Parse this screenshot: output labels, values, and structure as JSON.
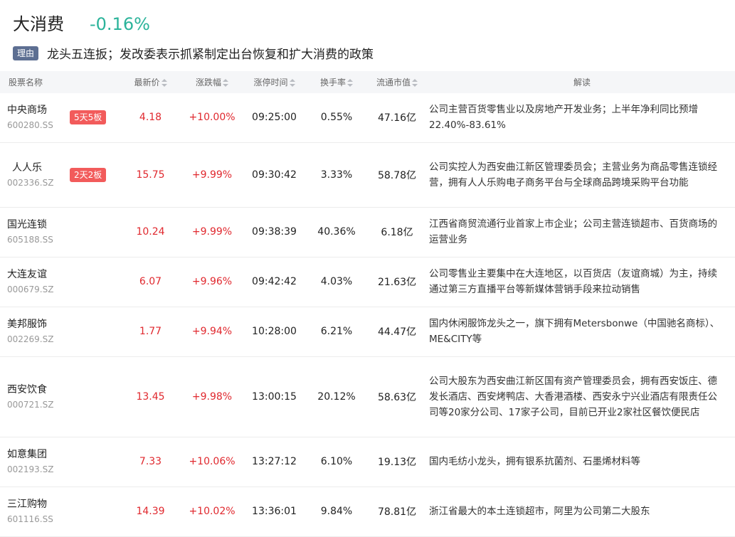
{
  "header": {
    "sector_name": "大消费",
    "sector_change": "-0.16%",
    "reason_tag": "理由",
    "reason_text": "龙头五连扳；发改委表示抓紧制定出台恢复和扩大消费的政策"
  },
  "table": {
    "columns": [
      "股票名称",
      "最新价",
      "涨跌幅",
      "涨停时间",
      "换手率",
      "流通市值",
      "解读"
    ],
    "rows": [
      {
        "name": "中央商场",
        "code": "600280.SS",
        "badge": "5天5板",
        "price": "4.18",
        "change": "+10.00%",
        "limit_time": "09:25:00",
        "turnover": "0.55%",
        "market_cap": "47.16亿",
        "desc": "公司主营百货零售业以及房地产开发业务；上半年净利同比预增22.40%-83.61%"
      },
      {
        "name": "人人乐",
        "code": "002336.SZ",
        "badge": "2天2板",
        "price": "15.75",
        "change": "+9.99%",
        "limit_time": "09:30:42",
        "turnover": "3.33%",
        "market_cap": "58.78亿",
        "desc": "公司实控人为西安曲江新区管理委员会；主营业务为商品零售连锁经营，拥有人人乐购电子商务平台与全球商品跨境采购平台功能"
      },
      {
        "name": "国光连锁",
        "code": "605188.SS",
        "badge": "",
        "price": "10.24",
        "change": "+9.99%",
        "limit_time": "09:38:39",
        "turnover": "40.36%",
        "market_cap": "6.18亿",
        "desc": "江西省商贸流通行业首家上市企业；公司主营连锁超市、百货商场的运营业务"
      },
      {
        "name": "大连友谊",
        "code": "000679.SZ",
        "badge": "",
        "price": "6.07",
        "change": "+9.96%",
        "limit_time": "09:42:42",
        "turnover": "4.03%",
        "market_cap": "21.63亿",
        "desc": "公司零售业主要集中在大连地区，以百货店（友谊商城）为主，持续通过第三方直播平台等新媒体营销手段来拉动销售"
      },
      {
        "name": "美邦服饰",
        "code": "002269.SZ",
        "badge": "",
        "price": "1.77",
        "change": "+9.94%",
        "limit_time": "10:28:00",
        "turnover": "6.21%",
        "market_cap": "44.47亿",
        "desc": "国内休闲服饰龙头之一，旗下拥有Metersbonwe（中国驰名商标）、ME&CITY等"
      },
      {
        "name": "西安饮食",
        "code": "000721.SZ",
        "badge": "",
        "price": "13.45",
        "change": "+9.98%",
        "limit_time": "13:00:15",
        "turnover": "20.12%",
        "market_cap": "58.63亿",
        "desc": "公司大股东为西安曲江新区国有资产管理委员会，拥有西安饭庄、德发长酒店、西安烤鸭店、大香港酒楼、西安永宁兴业酒店有限责任公司等20家分公司、17家子公司，目前已开业2家社区餐饮便民店"
      },
      {
        "name": "如意集团",
        "code": "002193.SZ",
        "badge": "",
        "price": "7.33",
        "change": "+10.06%",
        "limit_time": "13:27:12",
        "turnover": "6.10%",
        "market_cap": "19.13亿",
        "desc": "国内毛纺小龙头，拥有银系抗菌剂、石墨烯材料等"
      },
      {
        "name": "三江购物",
        "code": "601116.SS",
        "badge": "",
        "price": "14.39",
        "change": "+10.02%",
        "limit_time": "13:36:01",
        "turnover": "9.84%",
        "market_cap": "78.81亿",
        "desc": "浙江省最大的本土连锁超市，阿里为公司第二大股东"
      }
    ]
  },
  "colors": {
    "up": "#e0282e",
    "sector_change": "#2bb39a",
    "badge": "#f25b5b",
    "reason_tag": "#5d6f92"
  }
}
